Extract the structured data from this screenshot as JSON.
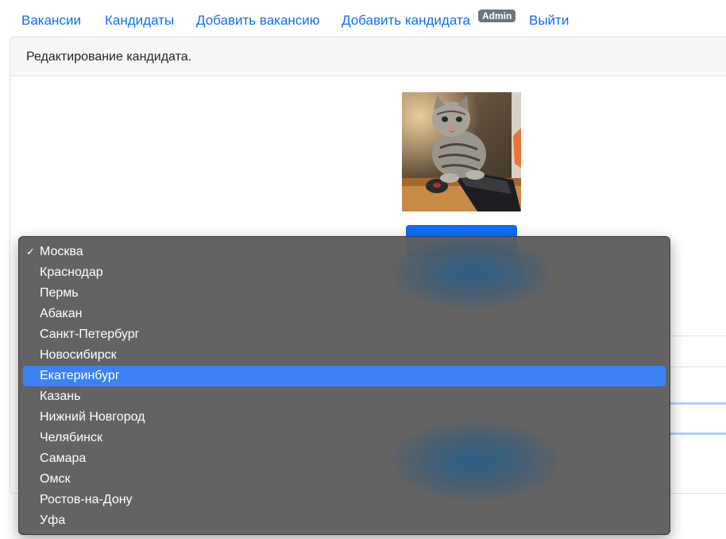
{
  "nav": {
    "vacancies": "Вакансии",
    "candidates": "Кандидаты",
    "add_vacancy": "Добавить вакансию",
    "add_candidate": "Добавить кандидата",
    "admin_badge": "Admin",
    "logout": "Выйти"
  },
  "card": {
    "header": "Редактирование кандидата."
  },
  "photo": {
    "icon": "cat-photo"
  },
  "city_select": {
    "selected": "Москва",
    "highlighted": "Екатеринбург",
    "options": [
      "Москва",
      "Краснодар",
      "Пермь",
      "Абакан",
      "Санкт-Петербург",
      "Новосибирск",
      "Екатеринбург",
      "Казань",
      "Нижний Новгород",
      "Челябинск",
      "Самара",
      "Омск",
      "Ростов-на-Дону",
      "Уфа"
    ]
  },
  "colors": {
    "link": "#0d6efd",
    "badge": "#6c757d",
    "popup_bg": "#5e5e5e",
    "highlight": "#3b82f6"
  }
}
